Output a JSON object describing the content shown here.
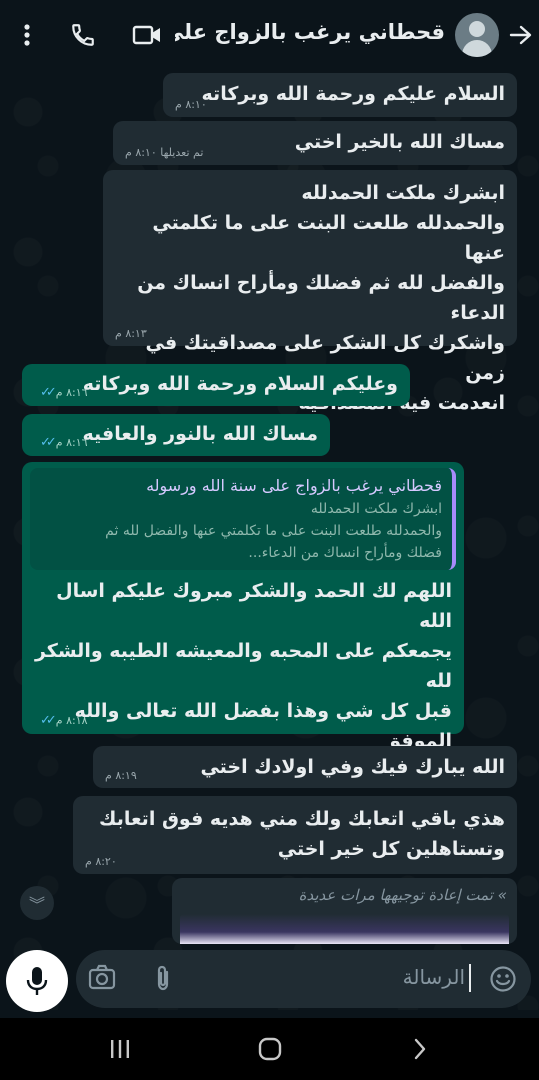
{
  "header": {
    "contact_name": "قحطاني يرغب بالزواج على ...",
    "icons": [
      "back-arrow-icon",
      "avatar",
      "video-call-icon",
      "phone-icon",
      "more-vert-icon"
    ]
  },
  "messages": [
    {
      "type": "in",
      "text": "السلام عليكم ورحمة الله وبركاته",
      "time": "٨:١٠ م"
    },
    {
      "type": "in",
      "text": "مساك الله بالخير اختي",
      "time": "تم تعديلها ٨:١٠ م"
    },
    {
      "type": "in",
      "text": "ابشرك ملكت الحمدلله\nوالحمدلله طلعت البنت على ما تكلمتي عنها\nوالفضل لله ثم فضلك ومأراح انساك من الدعاء\nواشكرك كل الشكر على مصداقيتك في زمن\nانعدمت فيه المصداقيه",
      "time": "٨:١٣ م"
    },
    {
      "type": "out",
      "text": "وعليكم السلام ورحمة الله وبركاته",
      "time": "٨:١٦ م"
    },
    {
      "type": "out",
      "text": "مساك الله بالنور والعافيه",
      "time": "٨:١٦ م"
    },
    {
      "type": "out",
      "quote_name": "قحطاني يرغب بالزواج على سنة الله ورسوله",
      "quote_text": "ابشرك ملكت الحمدلله\nوالحمدلله طلعت البنت على ما تكلمتي عنها والفضل لله ثم\nفضلك ومأراح انساك من الدعاء...",
      "text": "اللهم لك الحمد والشكر مبروك عليكم اسال الله\nيجمعكم على المحبه والمعيشه الطيبه والشكر لله\nقبل كل شي وهذا بفضل الله تعالى والله الموفق\nوالمجمع",
      "time": "٨:١٨ م"
    },
    {
      "type": "in",
      "text": "الله يبارك فيك وفي اولادك اختي",
      "time": "٨:١٩ م"
    },
    {
      "type": "in",
      "text": "هذي باقي اتعابك ولك مني هديه فوق اتعابك\nوتستاهلين كل خير اختي",
      "time": "٨:٢٠ م"
    }
  ],
  "forwarded": {
    "label": "تمت إعادة توجيهها مرات عديدة"
  },
  "input": {
    "placeholder": "الرسالة"
  },
  "colors": {
    "incoming": "#202c33",
    "outgoing": "#005c4b",
    "read_ticks": "#53bdeb",
    "background": "#0b141a"
  }
}
